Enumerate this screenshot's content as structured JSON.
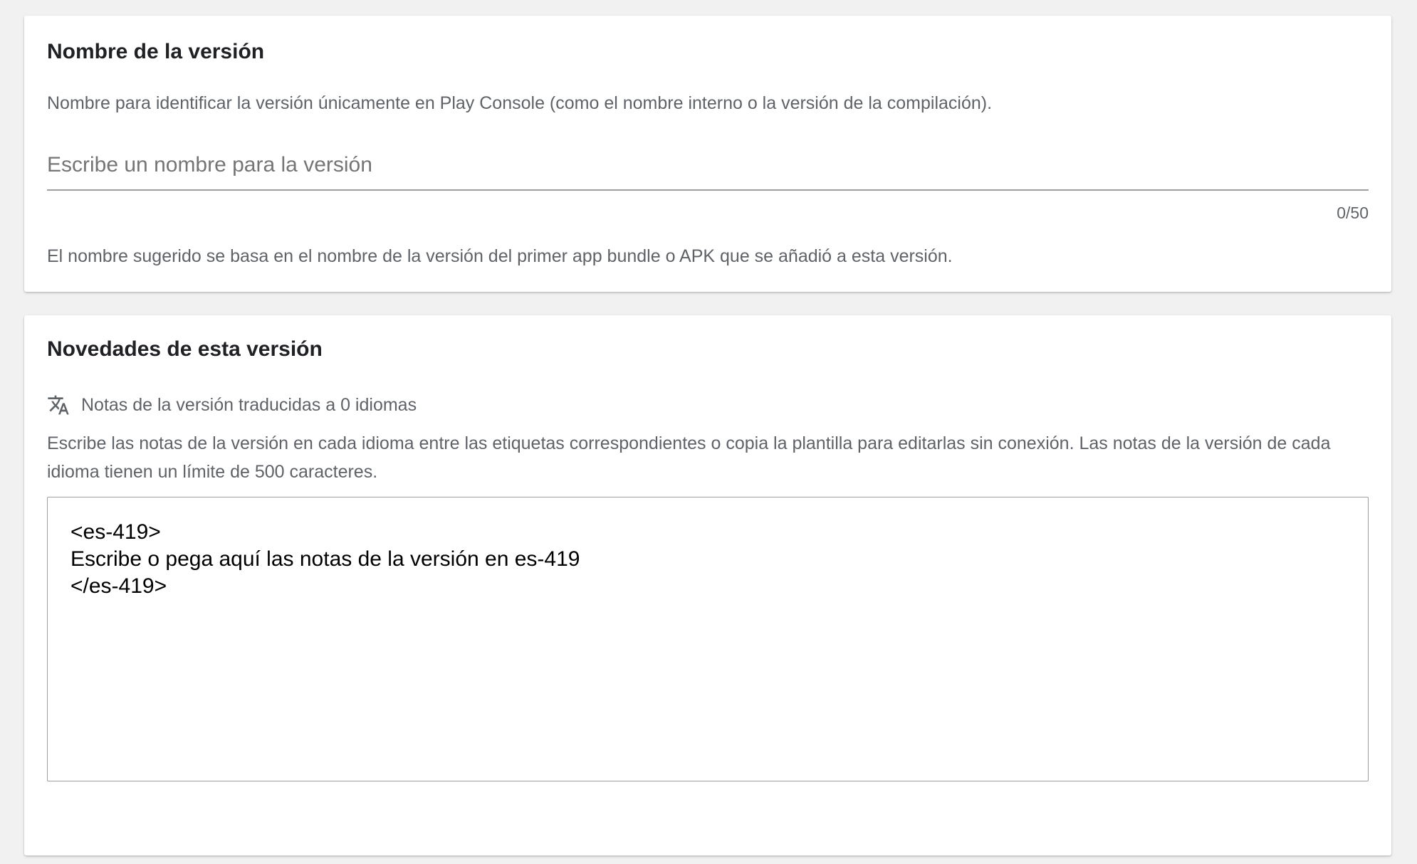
{
  "version_name_card": {
    "title": "Nombre de la versión",
    "description": "Nombre para identificar la versión únicamente en Play Console (como el nombre interno o la versión de la compilación).",
    "input": {
      "value": "",
      "placeholder": "Escribe un nombre para la versión"
    },
    "counter": "0/50",
    "hint": "El nombre sugerido se basa en el nombre de la versión del primer app bundle o APK que se añadió a esta versión."
  },
  "release_notes_card": {
    "title": "Novedades de esta versión",
    "translations": {
      "icon": "translate-icon",
      "label": "Notas de la versión traducidas a 0 idiomas"
    },
    "description": "Escribe las notas de la versión en cada idioma entre las etiquetas correspondientes o copia la plantilla para editarlas sin conexión. Las notas de la versión de cada idioma tienen un límite de 500 caracteres.",
    "notes_value": "<es-419>\nEscribe o pega aquí las notas de la versión en es-419\n</es-419>"
  },
  "colors": {
    "page_background": "#f1f1f1",
    "card_background": "#ffffff",
    "secondary_text": "#5f6368",
    "primary_text": "#202124"
  }
}
